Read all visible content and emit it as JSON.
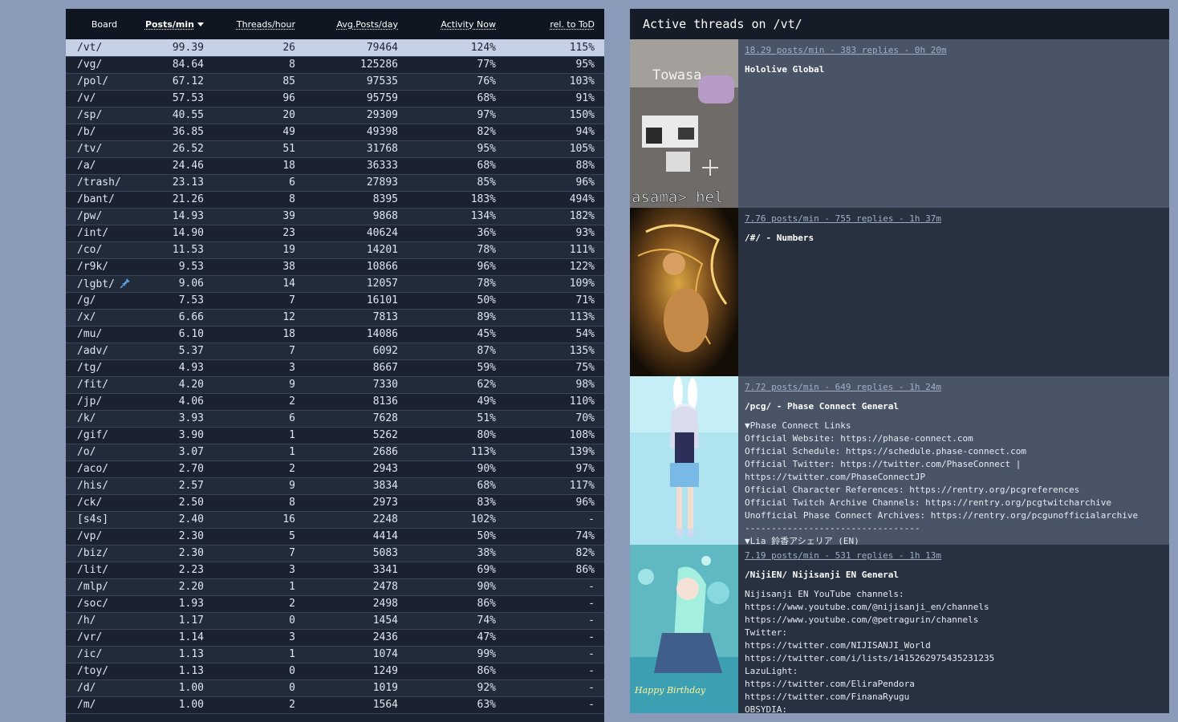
{
  "stats": {
    "headers": {
      "board": "Board",
      "posts_min": "Posts/min",
      "threads_hour": "Threads/hour",
      "avg_posts_day": "Avg.Posts/day",
      "activity_now": "Activity Now",
      "rel_tod": "rel. to ToD"
    },
    "rows": [
      {
        "board": "/vt/",
        "ppm": "99.39",
        "tph": "26",
        "avg": "79464",
        "act": "124%",
        "rel": "115%",
        "highlight": true
      },
      {
        "board": "/vg/",
        "ppm": "84.64",
        "tph": "8",
        "avg": "125286",
        "act": "77%",
        "rel": "95%"
      },
      {
        "board": "/pol/",
        "ppm": "67.12",
        "tph": "85",
        "avg": "97535",
        "act": "76%",
        "rel": "103%"
      },
      {
        "board": "/v/",
        "ppm": "57.53",
        "tph": "96",
        "avg": "95759",
        "act": "68%",
        "rel": "91%"
      },
      {
        "board": "/sp/",
        "ppm": "40.55",
        "tph": "20",
        "avg": "29309",
        "act": "97%",
        "rel": "150%"
      },
      {
        "board": "/b/",
        "ppm": "36.85",
        "tph": "49",
        "avg": "49398",
        "act": "82%",
        "rel": "94%"
      },
      {
        "board": "/tv/",
        "ppm": "26.52",
        "tph": "51",
        "avg": "31768",
        "act": "95%",
        "rel": "105%"
      },
      {
        "board": "/a/",
        "ppm": "24.46",
        "tph": "18",
        "avg": "36333",
        "act": "68%",
        "rel": "88%"
      },
      {
        "board": "/trash/",
        "ppm": "23.13",
        "tph": "6",
        "avg": "27893",
        "act": "85%",
        "rel": "96%"
      },
      {
        "board": "/bant/",
        "ppm": "21.26",
        "tph": "8",
        "avg": "8395",
        "act": "183%",
        "rel": "494%"
      },
      {
        "board": "/pw/",
        "ppm": "14.93",
        "tph": "39",
        "avg": "9868",
        "act": "134%",
        "rel": "182%"
      },
      {
        "board": "/int/",
        "ppm": "14.90",
        "tph": "23",
        "avg": "40624",
        "act": "36%",
        "rel": "93%"
      },
      {
        "board": "/co/",
        "ppm": "11.53",
        "tph": "19",
        "avg": "14201",
        "act": "78%",
        "rel": "111%"
      },
      {
        "board": "/r9k/",
        "ppm": "9.53",
        "tph": "38",
        "avg": "10866",
        "act": "96%",
        "rel": "122%"
      },
      {
        "board": "/lgbt/",
        "ppm": "9.06",
        "tph": "14",
        "avg": "12057",
        "act": "78%",
        "rel": "109%",
        "pinned": true
      },
      {
        "board": "/g/",
        "ppm": "7.53",
        "tph": "7",
        "avg": "16101",
        "act": "50%",
        "rel": "71%"
      },
      {
        "board": "/x/",
        "ppm": "6.66",
        "tph": "12",
        "avg": "7813",
        "act": "89%",
        "rel": "113%"
      },
      {
        "board": "/mu/",
        "ppm": "6.10",
        "tph": "18",
        "avg": "14086",
        "act": "45%",
        "rel": "54%"
      },
      {
        "board": "/adv/",
        "ppm": "5.37",
        "tph": "7",
        "avg": "6092",
        "act": "87%",
        "rel": "135%"
      },
      {
        "board": "/tg/",
        "ppm": "4.93",
        "tph": "3",
        "avg": "8667",
        "act": "59%",
        "rel": "75%"
      },
      {
        "board": "/fit/",
        "ppm": "4.20",
        "tph": "9",
        "avg": "7330",
        "act": "62%",
        "rel": "98%"
      },
      {
        "board": "/jp/",
        "ppm": "4.06",
        "tph": "2",
        "avg": "8136",
        "act": "49%",
        "rel": "110%"
      },
      {
        "board": "/k/",
        "ppm": "3.93",
        "tph": "6",
        "avg": "7628",
        "act": "51%",
        "rel": "70%"
      },
      {
        "board": "/gif/",
        "ppm": "3.90",
        "tph": "1",
        "avg": "5262",
        "act": "80%",
        "rel": "108%"
      },
      {
        "board": "/o/",
        "ppm": "3.07",
        "tph": "1",
        "avg": "2686",
        "act": "113%",
        "rel": "139%"
      },
      {
        "board": "/aco/",
        "ppm": "2.70",
        "tph": "2",
        "avg": "2943",
        "act": "90%",
        "rel": "97%"
      },
      {
        "board": "/his/",
        "ppm": "2.57",
        "tph": "9",
        "avg": "3834",
        "act": "68%",
        "rel": "117%"
      },
      {
        "board": "/ck/",
        "ppm": "2.50",
        "tph": "8",
        "avg": "2973",
        "act": "83%",
        "rel": "96%"
      },
      {
        "board": "[s4s]",
        "ppm": "2.40",
        "tph": "16",
        "avg": "2248",
        "act": "102%",
        "rel": "-"
      },
      {
        "board": "/vp/",
        "ppm": "2.30",
        "tph": "5",
        "avg": "4414",
        "act": "50%",
        "rel": "74%"
      },
      {
        "board": "/biz/",
        "ppm": "2.30",
        "tph": "7",
        "avg": "5083",
        "act": "38%",
        "rel": "82%"
      },
      {
        "board": "/lit/",
        "ppm": "2.23",
        "tph": "3",
        "avg": "3341",
        "act": "69%",
        "rel": "86%"
      },
      {
        "board": "/mlp/",
        "ppm": "2.20",
        "tph": "1",
        "avg": "2478",
        "act": "90%",
        "rel": "-"
      },
      {
        "board": "/soc/",
        "ppm": "1.93",
        "tph": "2",
        "avg": "2498",
        "act": "86%",
        "rel": "-"
      },
      {
        "board": "/h/",
        "ppm": "1.17",
        "tph": "0",
        "avg": "1454",
        "act": "74%",
        "rel": "-"
      },
      {
        "board": "/vr/",
        "ppm": "1.14",
        "tph": "3",
        "avg": "2436",
        "act": "47%",
        "rel": "-"
      },
      {
        "board": "/ic/",
        "ppm": "1.13",
        "tph": "1",
        "avg": "1074",
        "act": "99%",
        "rel": "-"
      },
      {
        "board": "/toy/",
        "ppm": "1.13",
        "tph": "0",
        "avg": "1249",
        "act": "86%",
        "rel": "-"
      },
      {
        "board": "/d/",
        "ppm": "1.00",
        "tph": "0",
        "avg": "1019",
        "act": "92%",
        "rel": "-"
      },
      {
        "board": "/m/",
        "ppm": "1.00",
        "tph": "2",
        "avg": "1564",
        "act": "63%",
        "rel": "-"
      }
    ]
  },
  "threads": {
    "header": "Active threads on /vt/",
    "items": [
      {
        "meta": "18.29 posts/min - 383 replies - 0h 20m",
        "title": "Hololive Global",
        "lines": [],
        "thumb": "minecraft",
        "tone": "a",
        "thumb_text": {
          "top": "Towasa",
          "bottom": "asama> hel"
        }
      },
      {
        "meta": "7.76 posts/min - 755 replies - 1h 37m",
        "title": "/#/ - Numbers",
        "lines": [],
        "thumb": "golden",
        "tone": "b"
      },
      {
        "meta": "7.72 posts/min - 649 replies - 1h 24m",
        "title": "/pcg/ - Phase Connect General",
        "thumb": "anime-blue",
        "tone": "a",
        "lines": [
          "▼Phase Connect Links",
          "Official Website: https://phase-connect.com",
          "Official Schedule: https://schedule.phase-connect.com",
          "Official Twitter: https://twitter.com/PhaseConnect |",
          "https://twitter.com/PhaseConnectJP",
          "Official Character References: https://rentry.org/pcgreferences",
          "Official Twitch Archive Channels: https://rentry.org/pcgtwitcharchive",
          "Unofficial Phase Connect Archives: https://rentry.org/pcgunofficialarchive",
          "---------------------------------",
          "▼Lia 鈴香アシェリア (EN)"
        ]
      },
      {
        "meta": "7.19 posts/min - 531 replies - 1h 13m",
        "title": "/NijiEN/ Nijisanji EN General",
        "thumb": "anime-teal",
        "tone": "b",
        "thumb_text": {
          "bottom": "Happy Birthday"
        },
        "lines": [
          "Nijisanji EN YouTube channels:",
          "https://www.youtube.com/@nijisanji_en/channels",
          "https://www.youtube.com/@petragurin/channels",
          "Twitter:",
          "https://twitter.com/NIJISANJI_World",
          "https://twitter.com/i/lists/1415262975435231235",
          "LazuLight:",
          "https://twitter.com/EliraPendora",
          "https://twitter.com/FinanaRyugu",
          "OBSYDIA:"
        ]
      }
    ]
  },
  "colors": {
    "highlight_row": "#c5d1e6",
    "header_bg": "#0f1621",
    "panel_bg": "#1b2432",
    "page_bg": "#8a9ab8",
    "link": "#9fb0c6"
  }
}
